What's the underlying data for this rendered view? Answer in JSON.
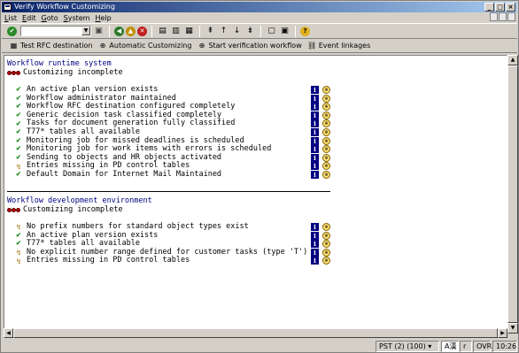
{
  "window": {
    "title": "Verify Workflow Customizing"
  },
  "menu": [
    {
      "ul": "L",
      "rest": "ist"
    },
    {
      "ul": "E",
      "rest": "dit"
    },
    {
      "ul": "G",
      "rest": "oto"
    },
    {
      "ul": "S",
      "rest": "ystem"
    },
    {
      "ul": "H",
      "rest": "elp"
    }
  ],
  "toolbar": {
    "command_value": ""
  },
  "app_toolbar": [
    {
      "icon": "test-icon",
      "glyph": "▦",
      "label": "Test RFC destination"
    },
    {
      "icon": "execute-icon",
      "glyph": "⊕",
      "label": "Automatic Customizing"
    },
    {
      "icon": "execute-icon",
      "glyph": "⊕",
      "label": "Start verification workflow"
    },
    {
      "icon": "linkage-icon",
      "glyph": "⛓",
      "label": "Event linkages"
    }
  ],
  "sections": [
    {
      "title": "Workflow runtime system",
      "status": "Customizing incomplete",
      "items": [
        {
          "state": "ok",
          "text": "An active plan version exists"
        },
        {
          "state": "ok",
          "text": "Workflow administrator maintained"
        },
        {
          "state": "ok",
          "text": "Workflow RFC destination configured completely"
        },
        {
          "state": "ok",
          "text": "Generic decision task classified completely"
        },
        {
          "state": "ok",
          "text": "Tasks for document generation fully classified"
        },
        {
          "state": "ok",
          "text": "T77* tables all available"
        },
        {
          "state": "ok",
          "text": "Monitoring job for missed deadlines is scheduled"
        },
        {
          "state": "ok",
          "text": "Monitoring job for work items with errors is scheduled"
        },
        {
          "state": "ok",
          "text": "Sending to objects and HR objects activated"
        },
        {
          "state": "warn",
          "text": "Entries missing in PD control tables"
        },
        {
          "state": "ok",
          "text": "Default Domain for Internet Mail Maintained"
        }
      ]
    },
    {
      "title": "Workflow development environment",
      "status": "Customizing incomplete",
      "items": [
        {
          "state": "warn",
          "text": "No prefix numbers for standard object types exist"
        },
        {
          "state": "ok",
          "text": "An active plan version exists"
        },
        {
          "state": "ok",
          "text": "T77* tables all available"
        },
        {
          "state": "warn",
          "text": "No explicit number range defined for customer tasks (type 'T')"
        },
        {
          "state": "warn",
          "text": "Entries missing in PD control tables"
        }
      ]
    }
  ],
  "statusbar": {
    "system": "PST (2) (100)",
    "dropdown": "▾",
    "ime": "A漢",
    "server": "r",
    "mode": "OVR",
    "time": "10:26"
  }
}
